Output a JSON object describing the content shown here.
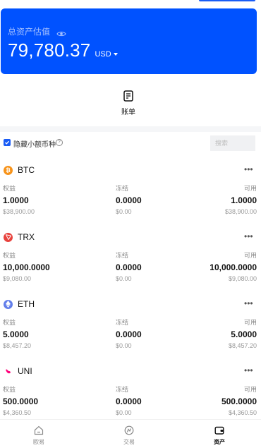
{
  "balance": {
    "label": "总资产估值",
    "value": "79,780.37",
    "currency": "USD"
  },
  "shortcuts": {
    "bill_label": "账单"
  },
  "filter": {
    "hide_small_label": "隐藏小额币种",
    "search_placeholder": "搜索"
  },
  "columns": {
    "equity": "权益",
    "frozen": "冻结",
    "available": "可用"
  },
  "assets": [
    {
      "symbol": "BTC",
      "logo_color": "#f7931a",
      "equity": "1.0000",
      "equity_usd": "$38,900.00",
      "frozen": "0.0000",
      "frozen_usd": "$0.00",
      "available": "1.0000",
      "available_usd": "$38,900.00"
    },
    {
      "symbol": "TRX",
      "logo_color": "#e8423d",
      "equity": "10,000.0000",
      "equity_usd": "$9,080.00",
      "frozen": "0.0000",
      "frozen_usd": "$0.00",
      "available": "10,000.0000",
      "available_usd": "$9,080.00"
    },
    {
      "symbol": "ETH",
      "logo_color": "#627eea",
      "equity": "5.0000",
      "equity_usd": "$8,457.20",
      "frozen": "0.0000",
      "frozen_usd": "$0.00",
      "available": "5.0000",
      "available_usd": "$8,457.20"
    },
    {
      "symbol": "UNI",
      "logo_color": "#ff007a",
      "equity": "500.0000",
      "equity_usd": "$4,360.50",
      "frozen": "0.0000",
      "frozen_usd": "$0.00",
      "available": "500.0000",
      "available_usd": "$4,360.50"
    }
  ],
  "nav": {
    "items": [
      {
        "label": "欧易",
        "icon": "home-icon",
        "active": false
      },
      {
        "label": "交易",
        "icon": "trade-icon",
        "active": false
      },
      {
        "label": "资产",
        "icon": "wallet-icon",
        "active": true
      }
    ]
  },
  "colors": {
    "accent": "#0052ff",
    "checkbox": "#1a5cf5"
  }
}
